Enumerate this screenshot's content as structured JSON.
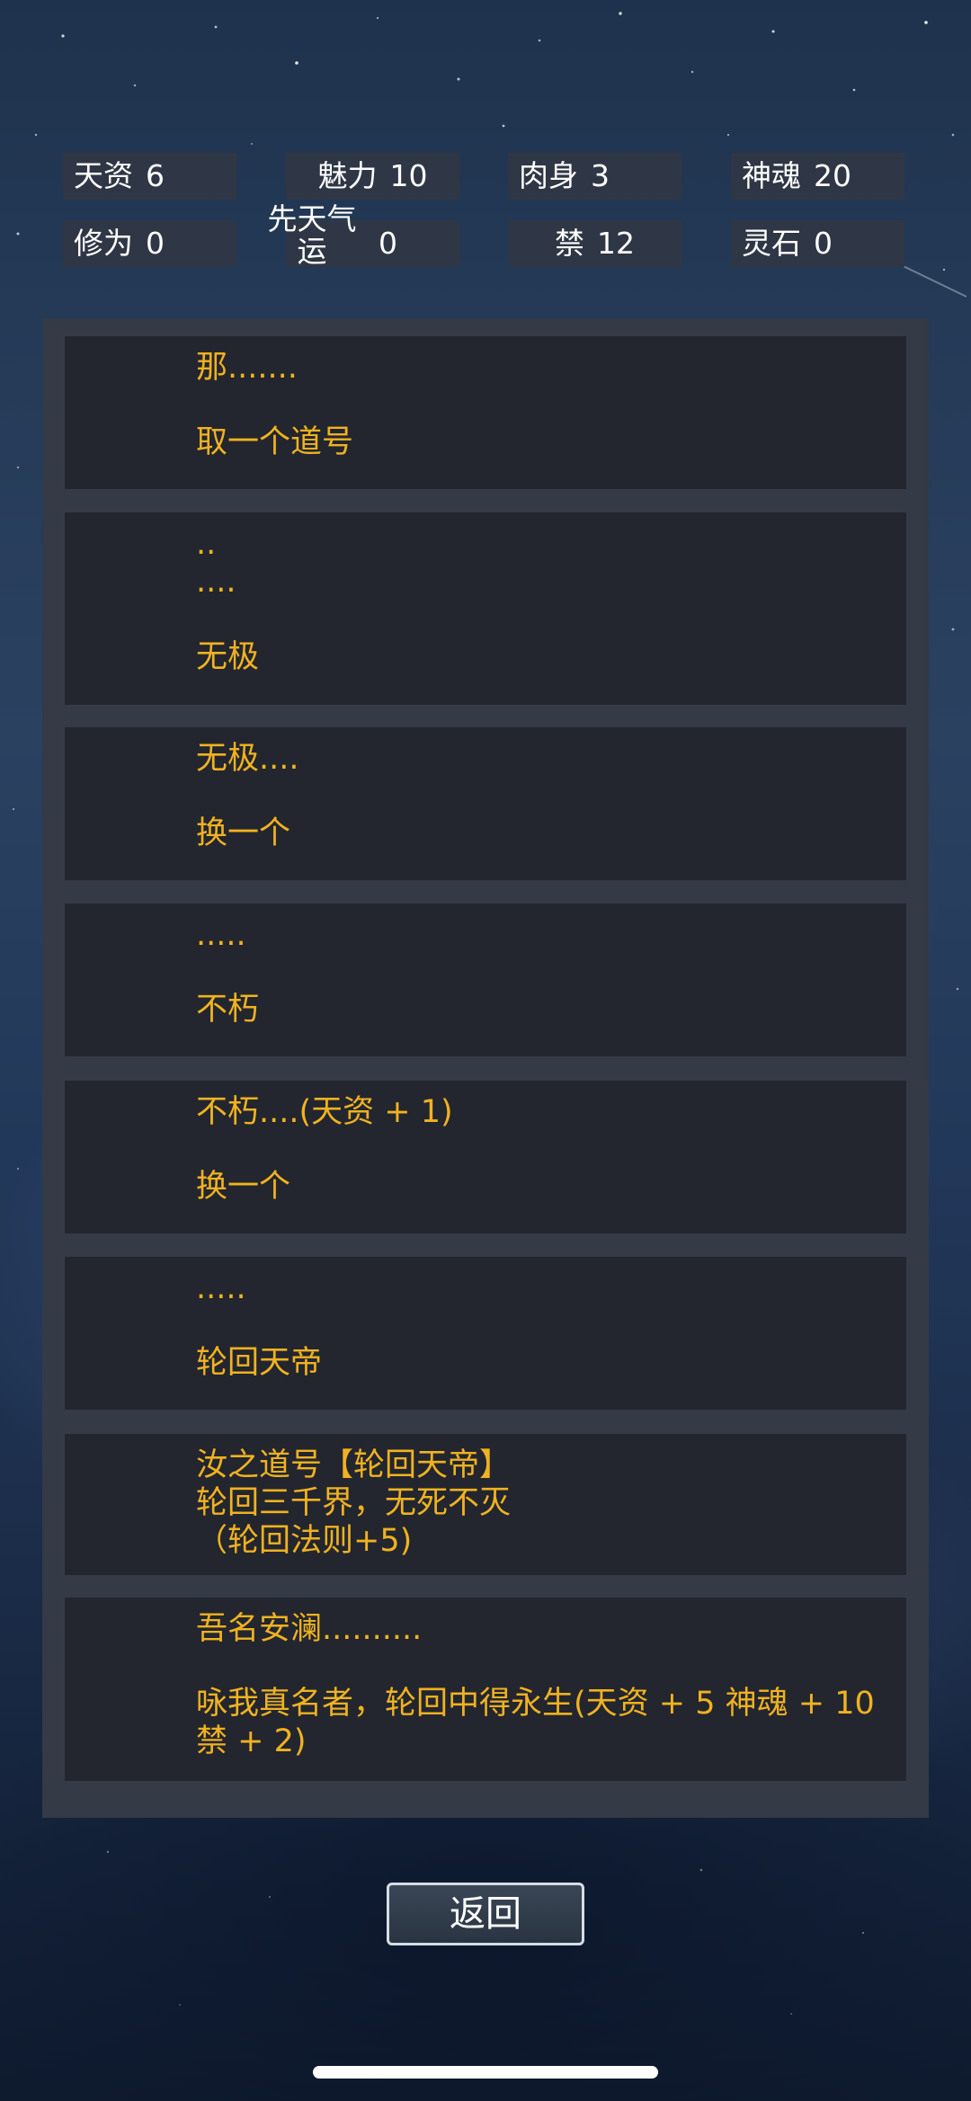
{
  "stats": [
    {
      "label": "天资",
      "value": "6"
    },
    {
      "label": "魅力",
      "value": "10"
    },
    {
      "label": "肉身",
      "value": "3"
    },
    {
      "label": "神魂",
      "value": "20"
    },
    {
      "label": "修为",
      "value": "0"
    },
    {
      "label": "先天气\n运",
      "value": "0"
    },
    {
      "label": "禁",
      "value": "12"
    },
    {
      "label": "灵石",
      "value": "0"
    }
  ],
  "dialog": [
    {
      "line1": "那.......",
      "line2": "取一个道号"
    },
    {
      "line1": "..\n....",
      "line2": "无极"
    },
    {
      "line1": "无极....",
      "line2": "换一个"
    },
    {
      "line1": ".....",
      "line2": "不朽"
    },
    {
      "line1": "不朽....(天资 + 1)",
      "line2": "换一个"
    },
    {
      "line1": ".....",
      "line2": "轮回天帝"
    },
    {
      "line1": "汝之道号【轮回天帝】\n轮回三千界，无死不灭\n（轮回法则+5)"
    },
    {
      "line1": "吾名安澜..........",
      "line2": "咏我真名者，轮回中得永生(天资 + 5 神魂 + 10 禁 + 2)"
    }
  ],
  "back_label": "返回",
  "colors": {
    "dialog_text": "#f0b220",
    "panel_bg": "#343a46",
    "entry_bg": "#23262f",
    "stat_bg": "#2f3746"
  }
}
